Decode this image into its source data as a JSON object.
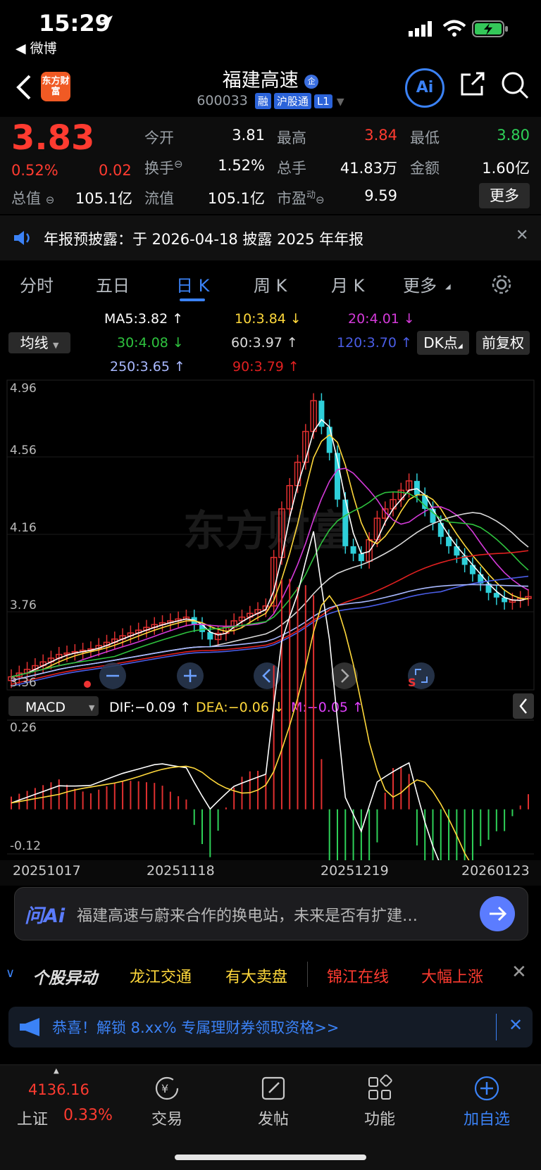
{
  "status_bar": {
    "time": "15:29",
    "back_app": "◀ 微博"
  },
  "header": {
    "title": "福建高速",
    "title_badge": "企",
    "code": "600033",
    "tags": [
      "融",
      "沪股通",
      "L1"
    ],
    "logo_text": "东方财富",
    "ai_label": "Ai"
  },
  "quote": {
    "price": "3.83",
    "change_pct": "0.52%",
    "change": "0.02",
    "fields": {
      "open_label": "今开",
      "open": "3.81",
      "high_label": "最高",
      "high": "3.84",
      "low_label": "最低",
      "low": "3.80",
      "turnover_label": "换手",
      "turnover": "1.52%",
      "volume_label": "总手",
      "volume": "41.83万",
      "amount_label": "金额",
      "amount": "1.60亿",
      "mcap_label": "总值",
      "mcap": "105.1亿",
      "float_label": "流值",
      "float": "105.1亿",
      "pe_label": "市盈",
      "pe_sup": "动",
      "pe": "9.59"
    },
    "more_button": "更多"
  },
  "notice": {
    "text": "年报预披露：于 2026-04-18 披露 2025 年年报"
  },
  "tabs": [
    "分时",
    "五日",
    "日 K",
    "周 K",
    "月 K",
    "更多"
  ],
  "active_tab": "日 K",
  "indicators": {
    "mode": "均线",
    "ma5": "MA5:3.82 ↑",
    "ma10": "10:3.84 ↓",
    "ma20": "20:4.01 ↓",
    "ma30": "30:4.08 ↓",
    "ma60": "60:3.97 ↑",
    "ma120": "120:3.70 ↑",
    "ma250": "250:3.65 ↑",
    "ma90": "90:3.79 ↑",
    "dk_button": "DK点",
    "adjust_button": "前复权",
    "colors": {
      "ma5": "#ffffff",
      "ma10": "#ffd83b",
      "ma20": "#d43ad9",
      "ma30": "#2ec23e",
      "ma60": "#d9d9d9",
      "ma120": "#4a5de6",
      "ma250": "#a9b9ff",
      "ma90": "#e02020"
    }
  },
  "kchart": {
    "y_labels": [
      "4.96",
      "4.56",
      "4.16",
      "3.76",
      "3.36"
    ],
    "watermark": "东方财富"
  },
  "macd": {
    "mode": "MACD",
    "dif": "DIF:−0.09 ↑",
    "dea": "DEA:−0.06 ↓",
    "m": "M:−0.05 ↑",
    "y_top": "0.26",
    "y_bottom": "-0.12"
  },
  "x_dates": [
    "20251017",
    "20251118",
    "20251219",
    "20260123"
  ],
  "ai_bar": {
    "brand": "问Ai",
    "prompt": "福建高速与蔚来合作的换电站，未来是否有扩建…"
  },
  "ticker": {
    "label": "个股异动",
    "items": [
      "龙江交通",
      "有大卖盘",
      "锦江在线",
      "大幅上涨"
    ]
  },
  "promo": {
    "text": "恭喜！解锁 8.xx% 专属理财券领取资格>>"
  },
  "bottom_nav": {
    "index_value": "4136.16",
    "index_name": "上证",
    "index_pct": "0.33%",
    "items": [
      "交易",
      "发帖",
      "功能",
      "加自选"
    ]
  }
}
